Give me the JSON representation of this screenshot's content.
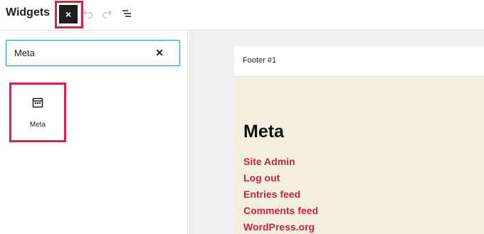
{
  "header": {
    "title": "Widgets",
    "close_label": "×"
  },
  "search": {
    "value": "Meta",
    "clear_label": "✕"
  },
  "block": {
    "icon": "calendar-icon",
    "label": "Meta"
  },
  "widget_area": {
    "title": "Footer #1",
    "heading": "Meta",
    "links": [
      "Site Admin",
      "Log out",
      "Entries feed",
      "Comments feed",
      "WordPress.org"
    ]
  },
  "colors": {
    "accent": "#e01e4a",
    "link": "#c81e4a",
    "focus": "#3582c4",
    "area_bg": "#f5efe0"
  }
}
